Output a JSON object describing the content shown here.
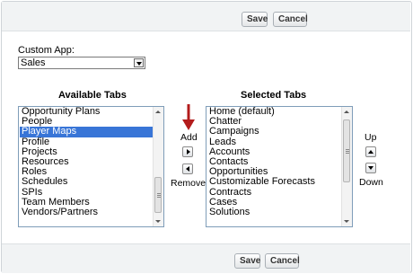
{
  "toolbar": {
    "save_label": "Save",
    "cancel_label": "Cancel"
  },
  "custom_app": {
    "label": "Custom App:",
    "selected": "Sales"
  },
  "available_tabs": {
    "heading": "Available Tabs",
    "items": [
      "Opportunity Plans",
      "People",
      "Player Maps",
      "Profile",
      "Projects",
      "Resources",
      "Roles",
      "Schedules",
      "SPIs",
      "Team Members",
      "Vendors/Partners"
    ],
    "selected": "Player Maps"
  },
  "selected_tabs": {
    "heading": "Selected Tabs",
    "items": [
      "Home (default)",
      "Chatter",
      "Campaigns",
      "Leads",
      "Accounts",
      "Contacts",
      "Opportunities",
      "Customizable Forecasts",
      "Contracts",
      "Cases",
      "Solutions"
    ]
  },
  "controls": {
    "add_label": "Add",
    "remove_label": "Remove",
    "up_label": "Up",
    "down_label": "Down"
  },
  "colors": {
    "selection": "#3875d7",
    "annotation_arrow": "#b31c1c",
    "button_bar": "#f1f3f4"
  }
}
